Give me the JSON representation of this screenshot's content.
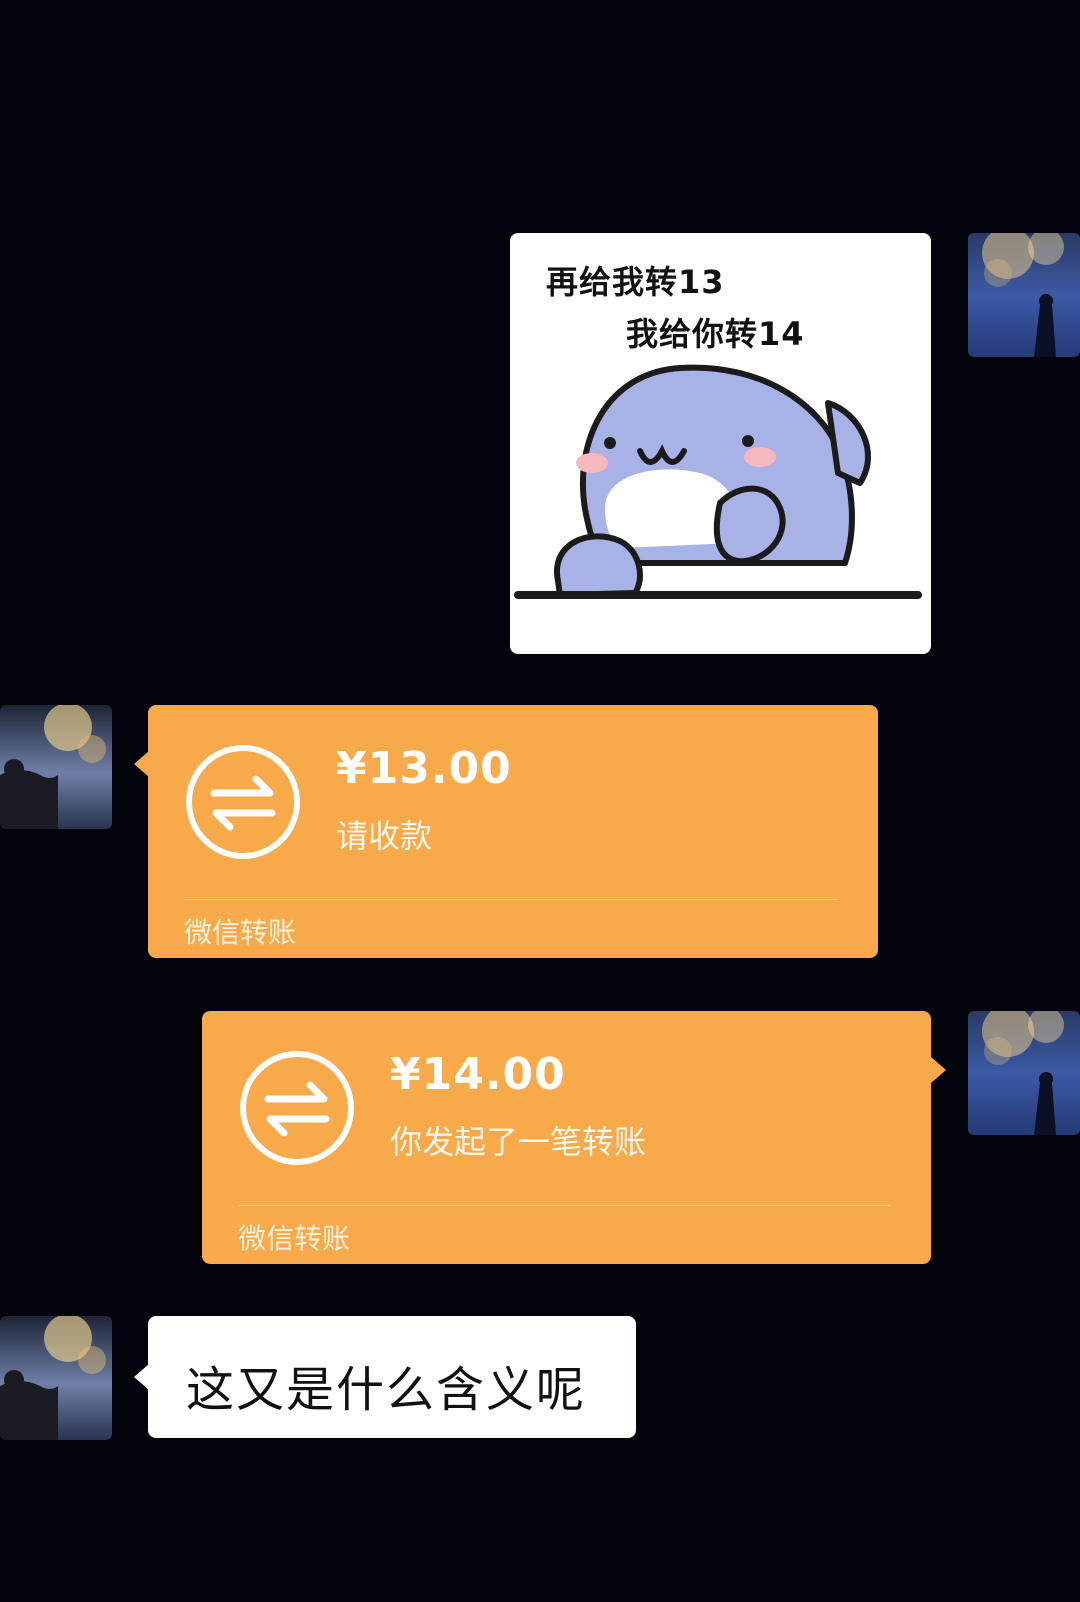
{
  "messages": [
    {
      "type": "sticker",
      "side": "right",
      "sticker": {
        "line1": "再给我转13",
        "line2": "我给你转14",
        "icon": "shark-sticker"
      }
    },
    {
      "type": "transfer",
      "side": "left",
      "amount": "¥13.00",
      "description": "请收款",
      "brand": "微信转账",
      "icon": "transfer-arrows-icon"
    },
    {
      "type": "transfer",
      "side": "right",
      "amount": "¥14.00",
      "description": "你发起了一笔转账",
      "brand": "微信转账",
      "icon": "transfer-arrows-icon"
    },
    {
      "type": "text",
      "side": "left",
      "text": "这又是什么含义呢"
    }
  ],
  "colors": {
    "background": "#03040b",
    "transfer_card": "#f8a94a",
    "bubble": "#ffffff"
  }
}
